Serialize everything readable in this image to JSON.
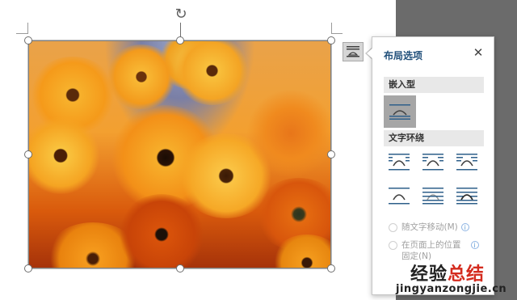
{
  "layout_panel": {
    "title": "布局选项",
    "close_glyph": "✕",
    "inline_section": "嵌入型",
    "wrap_section": "文字环绕",
    "move_with_text": "随文字移动(M)",
    "fix_position_line1": "在页面上的位置",
    "fix_position_line2": "固定(N)",
    "info_glyph": "i"
  },
  "watermark": {
    "cn_part1": "经验",
    "cn_part2": "总结",
    "en": "jingyanzongjie.cn"
  },
  "icons": {
    "rotate": "↻"
  },
  "colors": {
    "panel_title": "#1f4e79",
    "selected_option": "#a6a6a6",
    "watermark_accent": "#d42b1e"
  }
}
